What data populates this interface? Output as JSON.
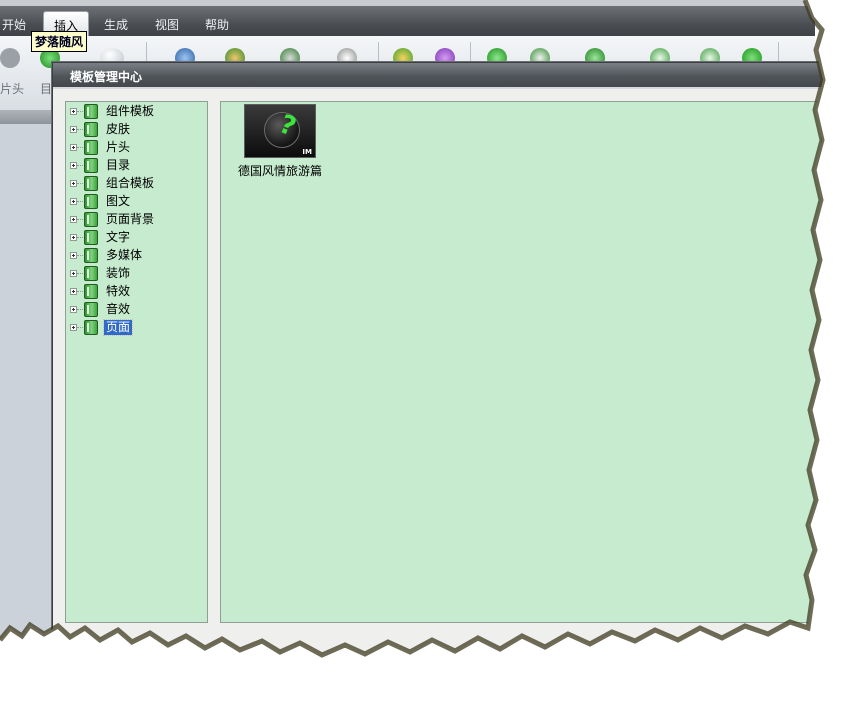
{
  "menubar": {
    "items": [
      {
        "label": "开始"
      },
      {
        "label": "插入"
      },
      {
        "label": "生成"
      },
      {
        "label": "视图"
      },
      {
        "label": "帮助"
      }
    ],
    "active_index": 1,
    "tooltip": "梦落随风"
  },
  "ribbon": {
    "left_labels": [
      "片头",
      "目"
    ]
  },
  "dialog": {
    "title": "模板管理中心",
    "tree": [
      {
        "label": "组件模板"
      },
      {
        "label": "皮肤"
      },
      {
        "label": "片头"
      },
      {
        "label": "目录"
      },
      {
        "label": "组合模板"
      },
      {
        "label": "图文"
      },
      {
        "label": "页面背景"
      },
      {
        "label": "文字"
      },
      {
        "label": "多媒体"
      },
      {
        "label": "装饰"
      },
      {
        "label": "特效"
      },
      {
        "label": "音效"
      },
      {
        "label": "页面"
      }
    ],
    "selected_tree_index": 12,
    "templates": [
      {
        "name": "德国风情旅游篇",
        "thumb_badge": "IM"
      }
    ]
  },
  "colors": {
    "panel_bg": "#c7ebcf",
    "selection": "#3169c6",
    "titlebar": "#50555a"
  }
}
